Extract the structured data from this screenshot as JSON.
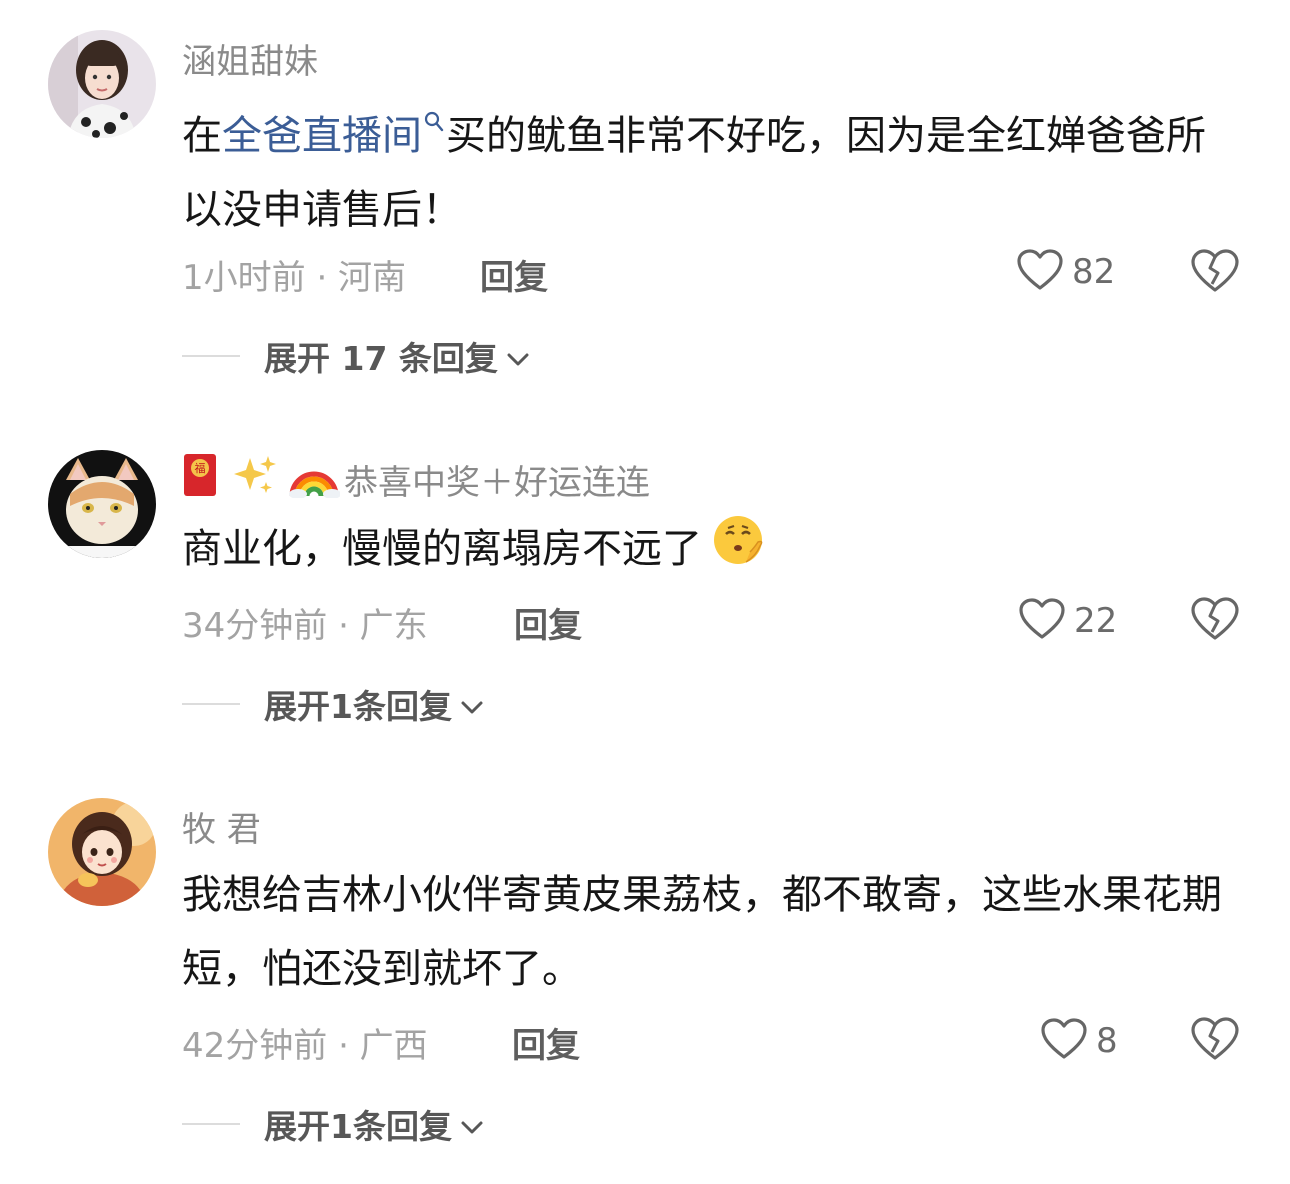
{
  "comments": [
    {
      "username": "涵姐甜妹",
      "content_prefix": "在",
      "content_link": "全爸直播间",
      "content_suffix": "买的鱿鱼非常不好吃，因为是全红婵爸爸所以没申请售后！",
      "time_location": "1小时前 · 河南",
      "reply_label": "回复",
      "likes": "82",
      "expand_label": "展开 17 条回复"
    },
    {
      "username": "恭喜中奖＋好运连连",
      "content": "商业化，慢慢的离塌房不远了",
      "time_location": "34分钟前 · 广东",
      "reply_label": "回复",
      "likes": "22",
      "expand_label": "展开1条回复"
    },
    {
      "username": "牧 君",
      "content": "我想给吉林小伙伴寄黄皮果荔枝，都不敢寄，这些水果花期短，怕还没到就坏了。",
      "time_location": "42分钟前 · 广西",
      "reply_label": "回复",
      "likes": "8",
      "expand_label": "展开1条回复"
    }
  ],
  "icons": {
    "like": "heart-outline-icon",
    "dislike": "broken-heart-icon",
    "expand": "chevron-down-icon",
    "search": "search-icon",
    "username_emojis": [
      "red-envelope-icon",
      "sparkles-icon",
      "rainbow-icon"
    ],
    "content_emoji": "shushing-face-icon"
  },
  "colors": {
    "link": "#3b5d96",
    "meta": "#a3a3a3",
    "username": "#8a8a8a"
  }
}
